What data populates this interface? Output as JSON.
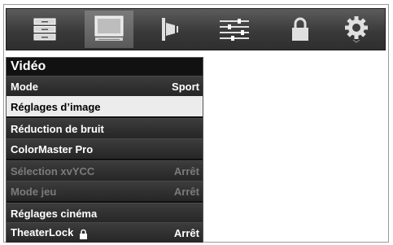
{
  "icon_bar": {
    "icons": [
      {
        "name": "setup-list-icon"
      },
      {
        "name": "picture-monitor-icon"
      },
      {
        "name": "audio-speaker-icon"
      },
      {
        "name": "sliders-icon"
      },
      {
        "name": "lock-icon"
      },
      {
        "name": "gear-icon"
      }
    ],
    "active_index": 1
  },
  "menu": {
    "title": "Vidéo",
    "items": [
      {
        "label": "Mode",
        "value": "Sport"
      },
      {
        "label": "Réglages d’image",
        "value": ""
      },
      {
        "label": "Réduction de bruit",
        "value": ""
      },
      {
        "label": "ColorMaster Pro",
        "value": ""
      },
      {
        "label": "Sélection xvYCC",
        "value": "Arrêt"
      },
      {
        "label": "Mode jeu",
        "value": "Arrêt"
      },
      {
        "label": "Réglages cinéma",
        "value": ""
      },
      {
        "label": "TheaterLock",
        "value": "Arrêt"
      }
    ]
  }
}
